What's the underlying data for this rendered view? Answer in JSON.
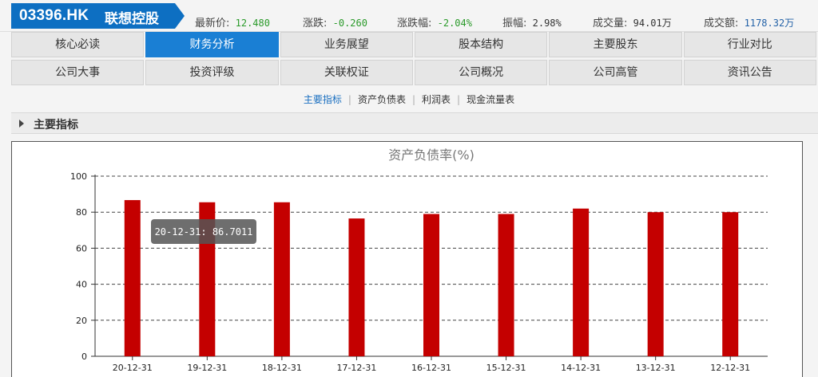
{
  "header": {
    "code": "03396.HK",
    "name": "联想控股",
    "quotes": [
      {
        "label": "最新价:",
        "value": "12.480",
        "color": "green"
      },
      {
        "label": "涨跌:",
        "value": "-0.260",
        "color": "green"
      },
      {
        "label": "涨跌幅:",
        "value": "-2.04%",
        "color": "green"
      },
      {
        "label": "振幅:",
        "value": "2.98%",
        "color": "dark"
      },
      {
        "label": "成交量:",
        "value": "94.01万",
        "color": "dark"
      },
      {
        "label": "成交额:",
        "value": "1178.32万",
        "color": "blue"
      }
    ]
  },
  "nav": {
    "row1": [
      "核心必读",
      "财务分析",
      "业务展望",
      "股本结构",
      "主要股东",
      "行业对比"
    ],
    "row2": [
      "公司大事",
      "投资评级",
      "关联权证",
      "公司概况",
      "公司高管",
      "资讯公告"
    ],
    "active": "财务分析"
  },
  "subnav": {
    "items": [
      "主要指标",
      "资产负债表",
      "利润表",
      "现金流量表"
    ],
    "active": "主要指标"
  },
  "section": {
    "title": "主要指标"
  },
  "colors": {
    "accent": "#1a7fd4",
    "bar": "#c40000",
    "positive_down": "#2a9a2a"
  },
  "chart_data": {
    "type": "bar",
    "title": "资产负债率(%)",
    "categories": [
      "20-12-31",
      "19-12-31",
      "18-12-31",
      "17-12-31",
      "16-12-31",
      "15-12-31",
      "14-12-31",
      "13-12-31",
      "12-12-31"
    ],
    "values": [
      86.7011,
      85.5,
      85.5,
      76.5,
      79,
      79,
      82,
      80,
      80
    ],
    "ylim": [
      0,
      100
    ],
    "yticks": [
      0,
      20,
      40,
      60,
      80,
      100
    ],
    "grid": true,
    "tooltip": {
      "text": "20-12-31: 86.7011"
    }
  }
}
